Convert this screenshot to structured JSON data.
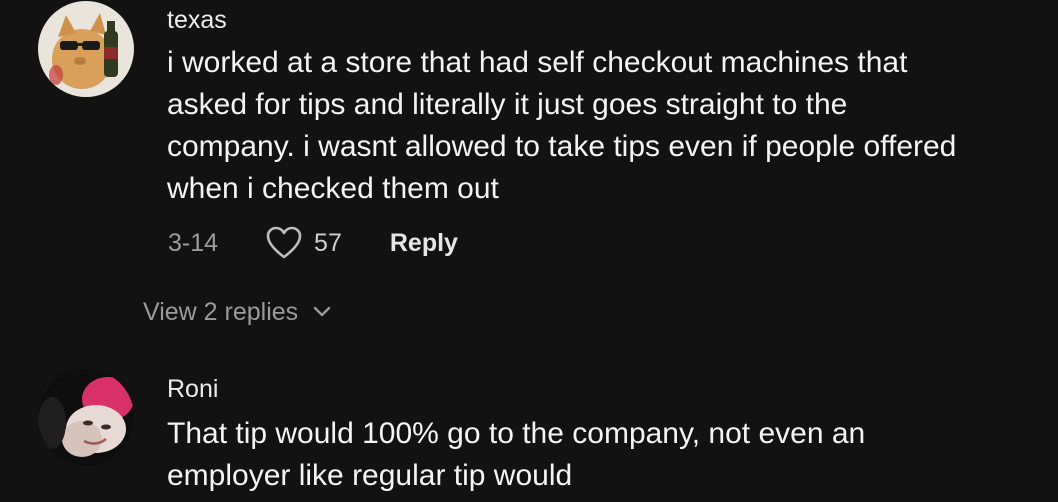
{
  "comments": [
    {
      "username": "texas",
      "avatar": "cat-with-sunglasses-and-wine-avatar",
      "lines": [
        "i worked at a store that had self checkout machines that",
        "asked for tips and literally it just goes straight to the",
        "company. i wasnt allowed to take tips even if people offered",
        "when i checked them out"
      ],
      "date": "3-14",
      "like_icon": "heart-outline-icon",
      "likes": "57",
      "reply_label": "Reply",
      "view_replies_label": "View 2 replies",
      "view_replies_icon": "chevron-down-icon"
    },
    {
      "username": "Roni",
      "avatar": "user-photo-avatar",
      "lines": [
        "That tip would 100% go to the company, not even an",
        "employer like regular tip would"
      ]
    }
  ],
  "colors": {
    "background": "#121212",
    "primary_text": "#f4f4f4",
    "secondary_text": "#9a9a9a"
  }
}
